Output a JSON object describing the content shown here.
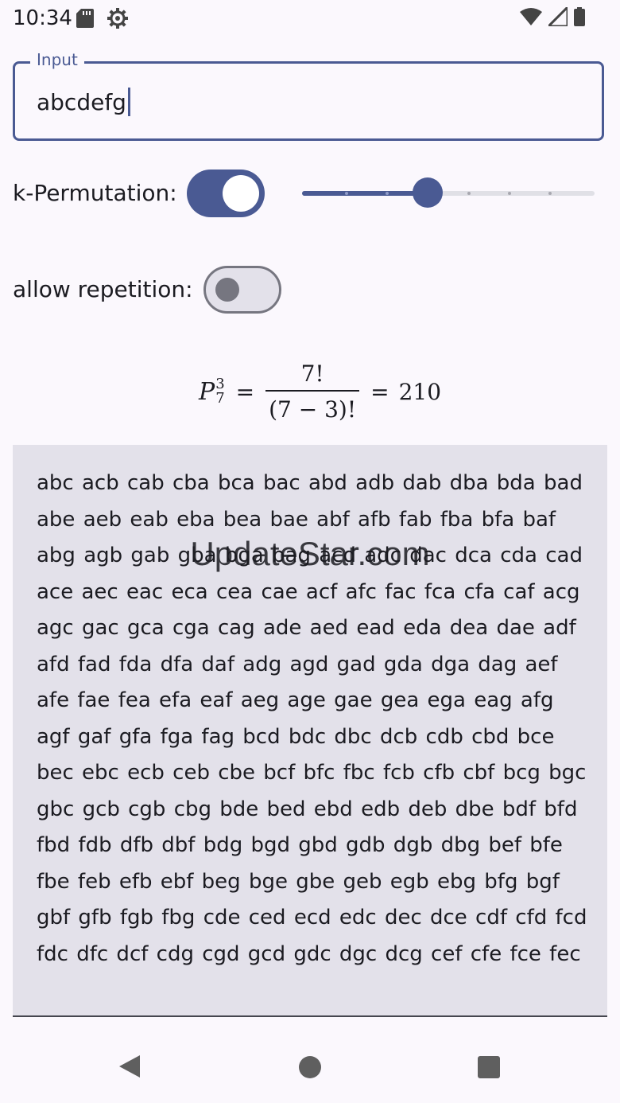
{
  "status_bar": {
    "time": "10:34",
    "icons": [
      "sd-card-icon",
      "gear-icon",
      "wifi-icon",
      "cellular-signal-icon",
      "battery-icon"
    ]
  },
  "input": {
    "label": "Input",
    "value": "abcdefg"
  },
  "k_permutation": {
    "label": "k-Permutation:",
    "enabled": true,
    "slider_value": 3,
    "slider_min": 0,
    "slider_max": 7
  },
  "repetition": {
    "label": "allow repetition:",
    "enabled": false
  },
  "formula": {
    "symbol": "P",
    "superscript": "3",
    "subscript": "7",
    "eq1": "=",
    "numerator": "7!",
    "denominator": "(7 − 3)!",
    "eq2": "=",
    "result": "210"
  },
  "output_text": "abc acb cab cba bca bac abd adb dab dba bda bad abe aeb eab eba bea bae abf afb fab fba bfa baf abg agb gab gba bga bag acd adc dac dca cda cad ace aec eac eca cea cae acf afc fac fca cfa caf acg agc gac gca cga cag ade aed ead eda dea dae adf afd fad fda dfa daf adg agd gad gda dga dag aef afe fae fea efa eaf aeg age gae gea ega eag afg agf gaf gfa fga fag bcd bdc dbc dcb cdb cbd bce bec ebc ecb ceb cbe bcf bfc fbc fcb cfb cbf bcg bgc gbc gcb cgb cbg bde bed ebd edb deb dbe bdf bfd fbd fdb dfb dbf bdg bgd gbd gdb dgb dbg bef bfe fbe feb efb ebf beg bge gbe geb egb ebg bfg bgf gbf gfb fgb fbg cde ced ecd edc dec dce cdf cfd fcd fdc dfc dcf cdg cgd gcd gdc dgc dcg cef cfe fce fec",
  "watermark": "UpdateStar.com",
  "colors": {
    "primary": "#4a5a93",
    "surface": "#fbf8fd",
    "output_bg": "#e3e1ea",
    "outline": "#767680"
  },
  "nav_bar": {
    "icons": [
      "back-icon",
      "home-icon",
      "recents-icon"
    ]
  }
}
